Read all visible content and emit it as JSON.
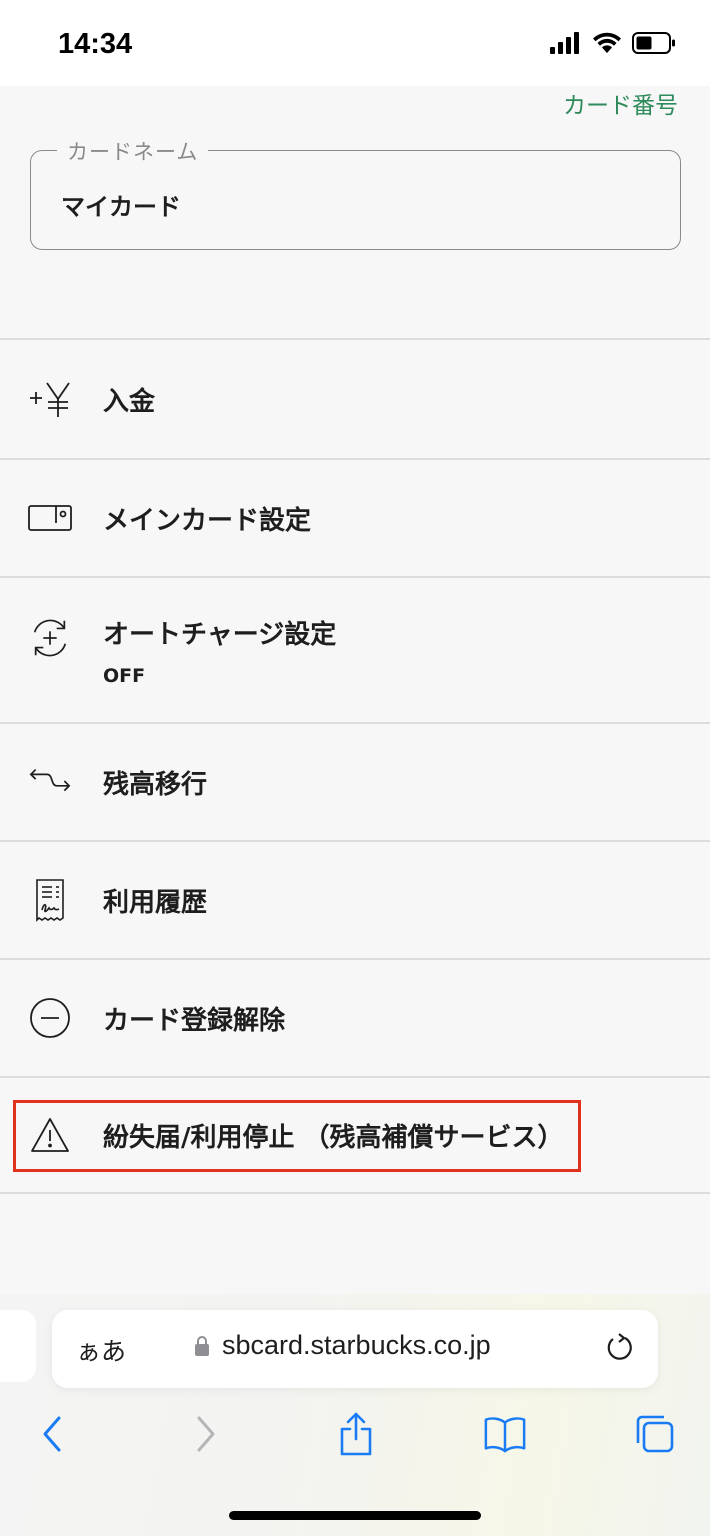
{
  "status_bar": {
    "time": "14:34"
  },
  "card": {
    "number_link": "カード番号",
    "name_label": "カードネーム",
    "name_value": "マイカード"
  },
  "menu": {
    "items": [
      {
        "label": "入金",
        "icon": "yen-plus-icon"
      },
      {
        "label": "メインカード設定",
        "icon": "card-icon"
      },
      {
        "label": "オートチャージ設定",
        "sub": "OFF",
        "icon": "auto-charge-icon"
      },
      {
        "label": "残高移行",
        "icon": "transfer-arrows-icon"
      },
      {
        "label": "利用履歴",
        "icon": "receipt-icon"
      },
      {
        "label": "カード登録解除",
        "icon": "minus-circle-icon"
      },
      {
        "label": "紛失届/利用停止 （残高補償サービス）",
        "icon": "warning-icon"
      }
    ]
  },
  "browser": {
    "aa_label": "ぁあ",
    "url": "sbcard.starbucks.co.jp"
  },
  "colors": {
    "accent_green": "#2e8a5a",
    "highlight_red": "#e0301e",
    "ios_blue": "#1a7cf5"
  }
}
